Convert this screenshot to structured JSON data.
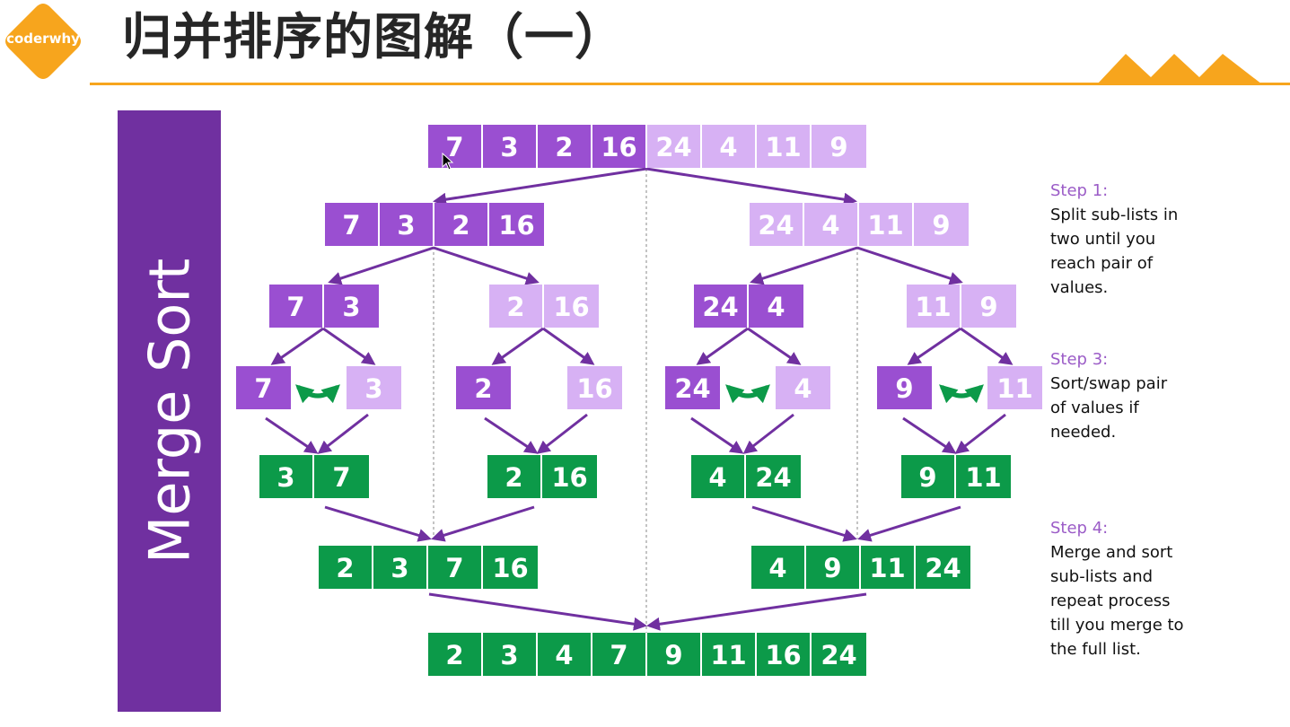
{
  "logo": {
    "text": "coderwhy",
    "color": "#f7a51d"
  },
  "header": {
    "title": "归并排序的图解（一）",
    "accent": "#f7a51d"
  },
  "sidebar": {
    "title": "Merge Sort",
    "color": "#7030a0"
  },
  "colors": {
    "dark": "#9a4fd1",
    "light": "#d7b1f4",
    "green": "#0c9a49",
    "arrow": "#7030a0",
    "swap": "#0c9a49"
  },
  "diagram": {
    "rows": [
      {
        "id": "original",
        "groups": [
          {
            "values": [
              "7",
              "3",
              "2",
              "16",
              "24",
              "4",
              "11",
              "9"
            ],
            "colors": [
              "dark",
              "dark",
              "dark",
              "dark",
              "light",
              "light",
              "light",
              "light"
            ]
          }
        ]
      },
      {
        "id": "split-halves",
        "groups": [
          {
            "values": [
              "7",
              "3",
              "2",
              "16"
            ],
            "colors": [
              "dark",
              "dark",
              "dark",
              "dark"
            ]
          },
          {
            "values": [
              "24",
              "4",
              "11",
              "9"
            ],
            "colors": [
              "light",
              "light",
              "light",
              "light"
            ]
          }
        ]
      },
      {
        "id": "split-pairs",
        "groups": [
          {
            "values": [
              "7",
              "3"
            ],
            "colors": [
              "dark",
              "dark"
            ]
          },
          {
            "values": [
              "2",
              "16"
            ],
            "colors": [
              "light",
              "light"
            ]
          },
          {
            "values": [
              "24",
              "4"
            ],
            "colors": [
              "dark",
              "dark"
            ]
          },
          {
            "values": [
              "11",
              "9"
            ],
            "colors": [
              "light",
              "light"
            ]
          }
        ]
      },
      {
        "id": "single-values",
        "groups": [
          {
            "values": [
              "7"
            ],
            "colors": [
              "dark"
            ]
          },
          {
            "values": [
              "3"
            ],
            "colors": [
              "light"
            ]
          },
          {
            "values": [
              "2"
            ],
            "colors": [
              "dark"
            ]
          },
          {
            "values": [
              "16"
            ],
            "colors": [
              "light"
            ]
          },
          {
            "values": [
              "24"
            ],
            "colors": [
              "dark"
            ]
          },
          {
            "values": [
              "4"
            ],
            "colors": [
              "light"
            ]
          },
          {
            "values": [
              "9"
            ],
            "colors": [
              "dark"
            ]
          },
          {
            "values": [
              "11"
            ],
            "colors": [
              "light"
            ]
          }
        ]
      },
      {
        "id": "sorted-pairs",
        "groups": [
          {
            "values": [
              "3",
              "7"
            ],
            "colors": [
              "green",
              "green"
            ]
          },
          {
            "values": [
              "2",
              "16"
            ],
            "colors": [
              "green",
              "green"
            ]
          },
          {
            "values": [
              "4",
              "24"
            ],
            "colors": [
              "green",
              "green"
            ]
          },
          {
            "values": [
              "9",
              "11"
            ],
            "colors": [
              "green",
              "green"
            ]
          }
        ]
      },
      {
        "id": "merged-halves",
        "groups": [
          {
            "values": [
              "2",
              "3",
              "7",
              "16"
            ],
            "colors": [
              "green",
              "green",
              "green",
              "green"
            ]
          },
          {
            "values": [
              "4",
              "9",
              "11",
              "24"
            ],
            "colors": [
              "green",
              "green",
              "green",
              "green"
            ]
          }
        ]
      },
      {
        "id": "final",
        "groups": [
          {
            "values": [
              "2",
              "3",
              "4",
              "7",
              "9",
              "11",
              "16",
              "24"
            ],
            "colors": [
              "green",
              "green",
              "green",
              "green",
              "green",
              "green",
              "green",
              "green"
            ]
          }
        ]
      }
    ],
    "swap_indicators": 3
  },
  "steps": [
    {
      "title": "Step 1:",
      "lines": [
        "Split sub-lists in",
        "two until you",
        "reach pair of",
        "values."
      ]
    },
    {
      "title": "Step 3:",
      "lines": [
        "Sort/swap pair",
        "of values if",
        "needed."
      ]
    },
    {
      "title": "Step 4:",
      "lines": [
        "Merge and sort",
        "sub-lists and",
        "repeat process",
        "till you merge to",
        "the full list."
      ]
    }
  ]
}
